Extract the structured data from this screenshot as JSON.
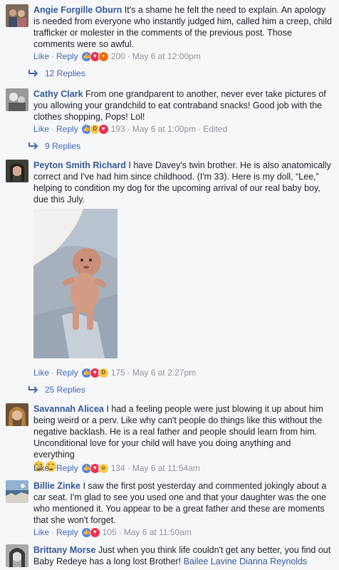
{
  "labels": {
    "like": "Like",
    "reply": "Reply",
    "edited": "Edited"
  },
  "comments": [
    {
      "author": "Angie Forgille Oburn",
      "text": "It's a shame he felt the need to explain. An apology is needed from everyone who instantly judged him, called him a creep, child trafficker or molester in the comments of the previous post. Those comments were so awful.",
      "count": "200",
      "time": "May 6 at 12:00pm",
      "replies": "12 Replies",
      "reactions": [
        "like-icon",
        "love-icon",
        "angry-icon"
      ]
    },
    {
      "author": "Cathy Clark",
      "text": "From one grandparent to another, never ever take pictures of you allowing your grandchild to eat contraband snacks! Good job with the clothes shopping, Pops! Lol!",
      "count": "193",
      "time": "May 6 at 1:00pm",
      "replies": "9 Replies",
      "reactions": [
        "like-icon",
        "haha-icon",
        "love-icon"
      ]
    },
    {
      "author": "Peyton Smith Richard",
      "text": "I have Davey's twin brother. He is also anatomically correct and I've had him since childhood. (I'm 33). Here is my doll, “Lee,” helping to condition my dog for the upcoming arrival of our real baby boy, due this July.",
      "count": "175",
      "time": "May 6 at 2:27pm",
      "replies": "25 Replies",
      "reactions": [
        "like-icon",
        "love-icon",
        "haha-icon"
      ]
    },
    {
      "author": "Savannah Alicea",
      "text": "I had a feeling people were just blowing it up about him being weird or a perv. Like why can't people do things like this without the negative backlash. He is a real father and people should learn from him. Unconditional love for your child will have you doing anything and everything",
      "count": "134",
      "time": "May 6 at 11:54am",
      "reactions": [
        "like-icon",
        "love-icon",
        "wow-icon"
      ]
    },
    {
      "author": "Billie Zinke",
      "text": "I saw the first post yesterday and commented jokingly about a car seat. I'm glad to see you used one and that your daughter was the one who mentioned it. You appear to be a great father and these are moments that she won't forget.",
      "count": "105",
      "time": "May 6 at 11:50am",
      "reactions": [
        "like-icon",
        "love-icon"
      ]
    },
    {
      "author": "Brittany Morse",
      "text": "Just when you think life couldn't get any better, you find out Baby Redeye has a long lost Brother!",
      "tag": "Bailee Lavine Dianna Reynolds"
    }
  ]
}
